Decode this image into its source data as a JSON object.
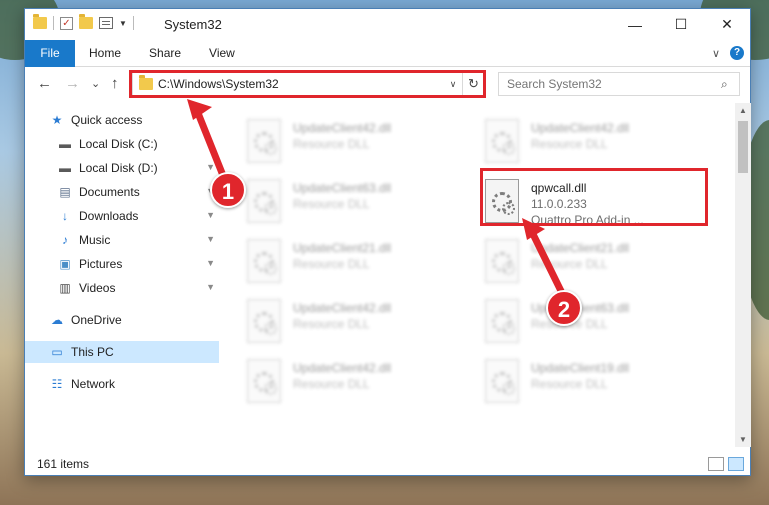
{
  "window": {
    "title": "System32",
    "controls": {
      "minimize": "—",
      "maximize": "☐",
      "close": "✕"
    }
  },
  "ribbon": {
    "file_tab": "File",
    "tabs": [
      "Home",
      "Share",
      "View"
    ],
    "expand_icon": "∨",
    "help": "?"
  },
  "navbar": {
    "back": "←",
    "forward": "→",
    "recent": "⌄",
    "up": "↑",
    "address": "C:\\Windows\\System32",
    "address_dropdown": "∨",
    "refresh": "↻",
    "search_placeholder": "Search System32",
    "search_icon": "⌕"
  },
  "sidebar": {
    "items": [
      {
        "label": "Quick access",
        "icon": "★",
        "icon_color": "#2b7cd3",
        "pinned": false
      },
      {
        "label": "Local Disk (C:)",
        "icon": "▬",
        "icon_color": "#5a5a5a",
        "pinned": true
      },
      {
        "label": "Local Disk (D:)",
        "icon": "▬",
        "icon_color": "#5a5a5a",
        "pinned": true
      },
      {
        "label": "Documents",
        "icon": "▤",
        "icon_color": "#5a6e8a",
        "pinned": true
      },
      {
        "label": "Downloads",
        "icon": "↓",
        "icon_color": "#2b7cd3",
        "pinned": true
      },
      {
        "label": "Music",
        "icon": "♪",
        "icon_color": "#2b7cd3",
        "pinned": true
      },
      {
        "label": "Pictures",
        "icon": "▣",
        "icon_color": "#4a8fc7",
        "pinned": true
      },
      {
        "label": "Videos",
        "icon": "▥",
        "icon_color": "#4a4a4a",
        "pinned": true
      },
      {
        "label": "OneDrive",
        "icon": "☁",
        "icon_color": "#2b7cd3",
        "pinned": false
      },
      {
        "label": "This PC",
        "icon": "▭",
        "icon_color": "#2b7cd3",
        "pinned": false
      },
      {
        "label": "Network",
        "icon": "☷",
        "icon_color": "#2b7cd3",
        "pinned": false
      }
    ],
    "pin_icon": "📌"
  },
  "files": [
    {
      "name": "UpdateClient42.dll",
      "sub": "Resource DLL",
      "blurred": true
    },
    {
      "name": "UpdateClient42.dll",
      "sub": "Resource DLL",
      "blurred": true
    },
    {
      "name": "UpdateClient63.dll",
      "sub": "Resource DLL",
      "blurred": true
    },
    {
      "name": "qpwcall.dll",
      "sub": "11.0.0.233",
      "sub2": "Quattro Pro Add-in ...",
      "blurred": false
    },
    {
      "name": "UpdateClient21.dll",
      "sub": "Resource DLL",
      "blurred": true
    },
    {
      "name": "UpdateClient21.dll",
      "sub": "Resource DLL",
      "blurred": true
    },
    {
      "name": "UpdateClient42.dll",
      "sub": "Resource DLL",
      "blurred": true
    },
    {
      "name": "UpdateClient63.dll",
      "sub": "Resource DLL",
      "blurred": true
    },
    {
      "name": "UpdateClient42.dll",
      "sub": "Resource DLL",
      "blurred": true
    },
    {
      "name": "UpdateClient19.dll",
      "sub": "Resource DLL",
      "blurred": true
    }
  ],
  "status": {
    "item_count": "161 items"
  },
  "scrollbar": {
    "up": "▲",
    "down": "▼"
  },
  "annotations": {
    "badge_1": "1",
    "badge_2": "2",
    "highlight_color": "#e0262c"
  }
}
